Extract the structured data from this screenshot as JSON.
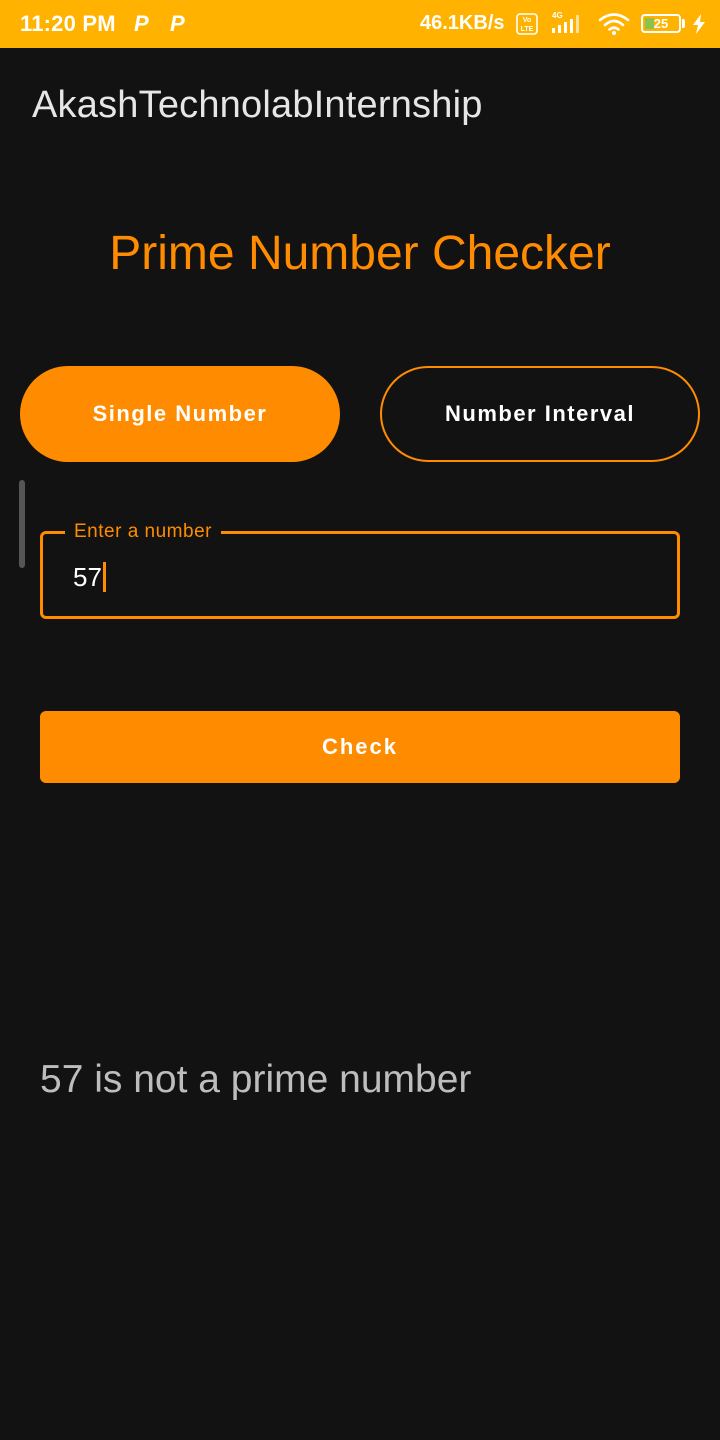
{
  "status_bar": {
    "time": "11:20 PM",
    "notification_icons": [
      "P",
      "P"
    ],
    "network_speed": "46.1KB/s",
    "volte_label": "Vo LTE",
    "network_type": "4G",
    "battery_level": "25",
    "battery_percent": 25,
    "icons": [
      "volte-icon",
      "signal-icon",
      "wifi-icon",
      "battery-icon",
      "charging-icon"
    ]
  },
  "app_bar": {
    "title": "AkashTechnolabInternship"
  },
  "main": {
    "heading": "Prime Number Checker",
    "modes": {
      "single_label": "Single Number",
      "interval_label": "Number Interval",
      "selected": "Single Number"
    },
    "input": {
      "label": "Enter a number",
      "value": "57"
    },
    "check_label": "Check",
    "result": "57 is not a prime number"
  },
  "colors": {
    "status_bar": "#FFB300",
    "background": "#121212",
    "accent": "#FF8C00",
    "title_text": "#E6E6E6",
    "result_text": "#BDBDBD"
  }
}
